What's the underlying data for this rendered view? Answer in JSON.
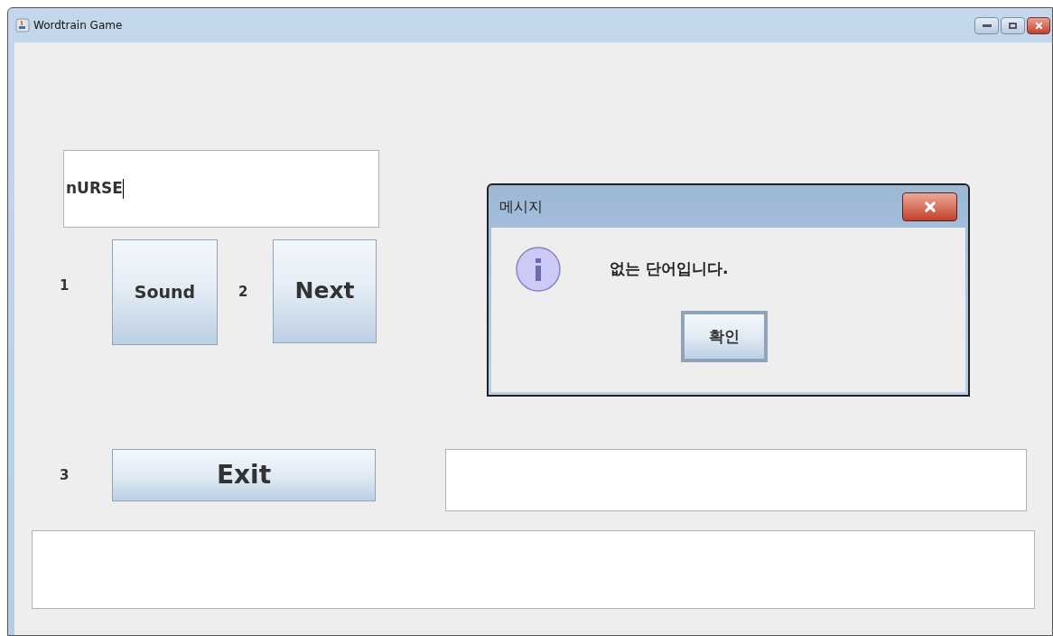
{
  "window": {
    "title": "Wordtrain Game"
  },
  "word_field": {
    "value": "nURSE"
  },
  "rows": [
    {
      "number": "1",
      "buttons": [
        {
          "label": "Sound",
          "kind": "small"
        },
        {
          "label": "Next",
          "kind": "large"
        }
      ],
      "between": "2"
    }
  ],
  "exit_row": {
    "number": "3",
    "button": "Exit"
  },
  "dialog": {
    "title": "메시지",
    "message": "없는 단어입니다.",
    "button": "확인"
  }
}
